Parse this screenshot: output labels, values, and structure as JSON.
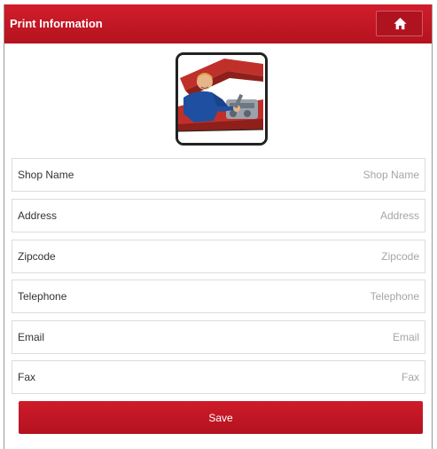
{
  "header": {
    "title": "Print Information",
    "home_icon": "home-icon"
  },
  "logo": {
    "icon": "mechanic-illustration"
  },
  "form": {
    "fields": [
      {
        "label": "Shop Name",
        "placeholder": "Shop Name",
        "value": ""
      },
      {
        "label": "Address",
        "placeholder": "Address",
        "value": ""
      },
      {
        "label": "Zipcode",
        "placeholder": "Zipcode",
        "value": ""
      },
      {
        "label": "Telephone",
        "placeholder": "Telephone",
        "value": ""
      },
      {
        "label": "Email",
        "placeholder": "Email",
        "value": ""
      },
      {
        "label": "Fax",
        "placeholder": "Fax",
        "value": ""
      }
    ],
    "save_label": "Save"
  },
  "colors": {
    "brand_red": "#c8172a",
    "background": "#ffffff",
    "field_border": "#dcdcdc",
    "placeholder_text": "#a5a5a5"
  }
}
